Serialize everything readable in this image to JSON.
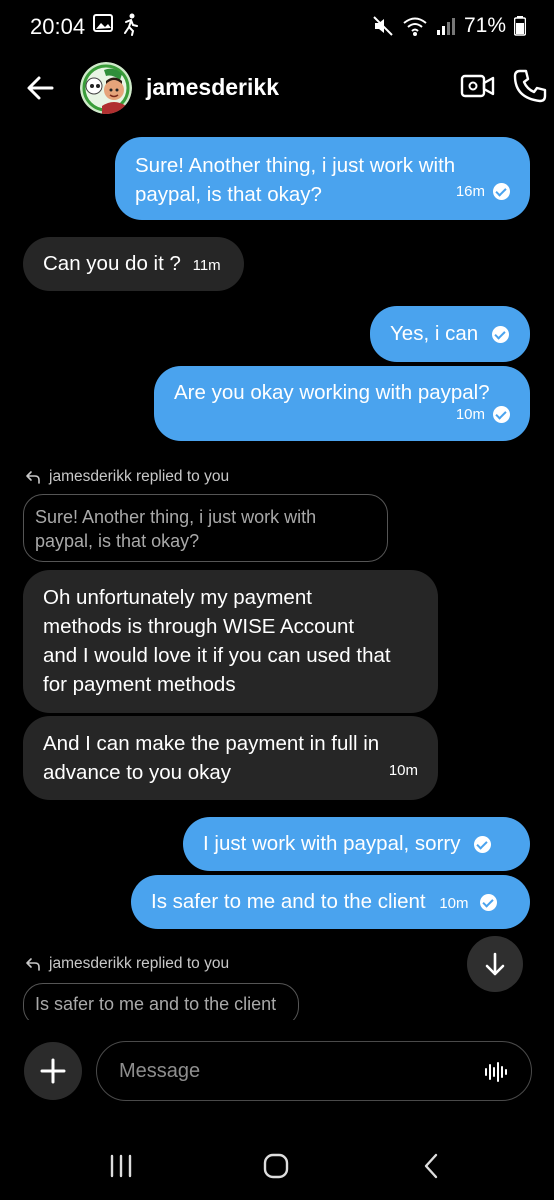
{
  "status_bar": {
    "time": "20:04",
    "battery": "71%"
  },
  "header": {
    "username": "jamesderikk"
  },
  "messages": [
    {
      "dir": "out",
      "lines": [
        "Sure! Another thing, i just work with",
        "paypal, is that okay?"
      ],
      "time": "16m"
    },
    {
      "dir": "in",
      "text": "Can you do it ?",
      "time": "11m"
    },
    {
      "dir": "out",
      "text": "Yes, i can"
    },
    {
      "dir": "out",
      "text": "Are you okay working with paypal?",
      "time": "10m"
    },
    {
      "dir": "in",
      "reply_label": "jamesderikk replied to you",
      "quoted_lines": [
        "Sure! Another thing, i just work with",
        "paypal, is that okay?"
      ],
      "lines": [
        "Oh unfortunately my payment",
        "methods is through WISE Account",
        "and I would love it if you can used that",
        "for payment methods"
      ]
    },
    {
      "dir": "in",
      "lines": [
        "And I can make the payment in full in",
        "advance to you okay"
      ],
      "time": "10m"
    },
    {
      "dir": "out",
      "text": "I just work with paypal, sorry"
    },
    {
      "dir": "out",
      "text": "Is safer to me and to the client",
      "time": "10m"
    },
    {
      "dir": "in",
      "reply_label": "jamesderikk replied to you",
      "quoted": "Is safer to me and to the client"
    }
  ],
  "composer": {
    "placeholder": "Message"
  },
  "colors": {
    "outgoing": "#4aa3ee",
    "incoming": "#262626",
    "background": "#000000"
  },
  "icons": [
    "back-arrow-icon",
    "video-call-icon",
    "phone-icon",
    "reply-arrow-icon",
    "chevron-down-icon",
    "plus-icon",
    "voice-wave-icon",
    "recent-apps-icon",
    "home-icon",
    "back-nav-icon"
  ]
}
